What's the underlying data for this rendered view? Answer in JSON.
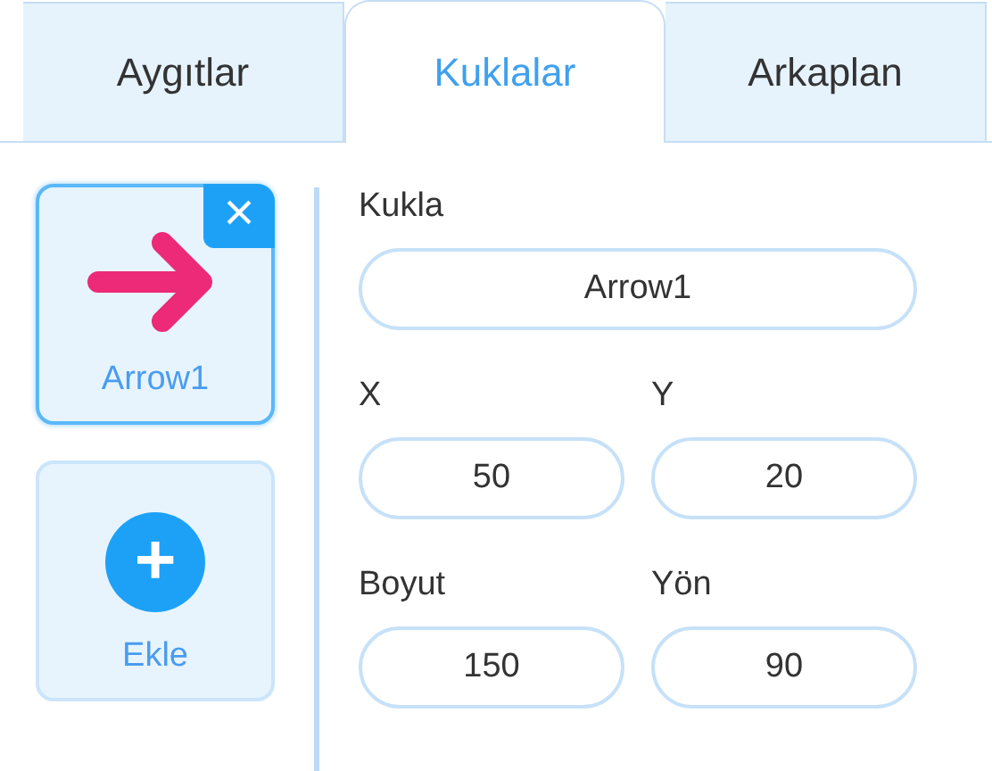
{
  "tabs": [
    {
      "label": "Aygıtlar",
      "selected": false
    },
    {
      "label": "Kuklalar",
      "selected": true
    },
    {
      "label": "Arkaplan",
      "selected": false
    }
  ],
  "sprites": [
    {
      "kind": "sprite",
      "name": "Arrow1",
      "selected": true,
      "delete": "×"
    },
    {
      "kind": "add",
      "name": "Ekle",
      "selected": false,
      "icon": "+"
    }
  ],
  "properties": [
    {
      "label": "Kukla",
      "value": "Arrow1",
      "wide": true
    },
    {
      "label": "X",
      "value": "50",
      "wide": false
    },
    {
      "label": "Y",
      "value": "20",
      "wide": false
    },
    {
      "label": "Boyut",
      "value": "150",
      "wide": false
    },
    {
      "label": "Yön",
      "value": "90",
      "wide": false
    }
  ]
}
